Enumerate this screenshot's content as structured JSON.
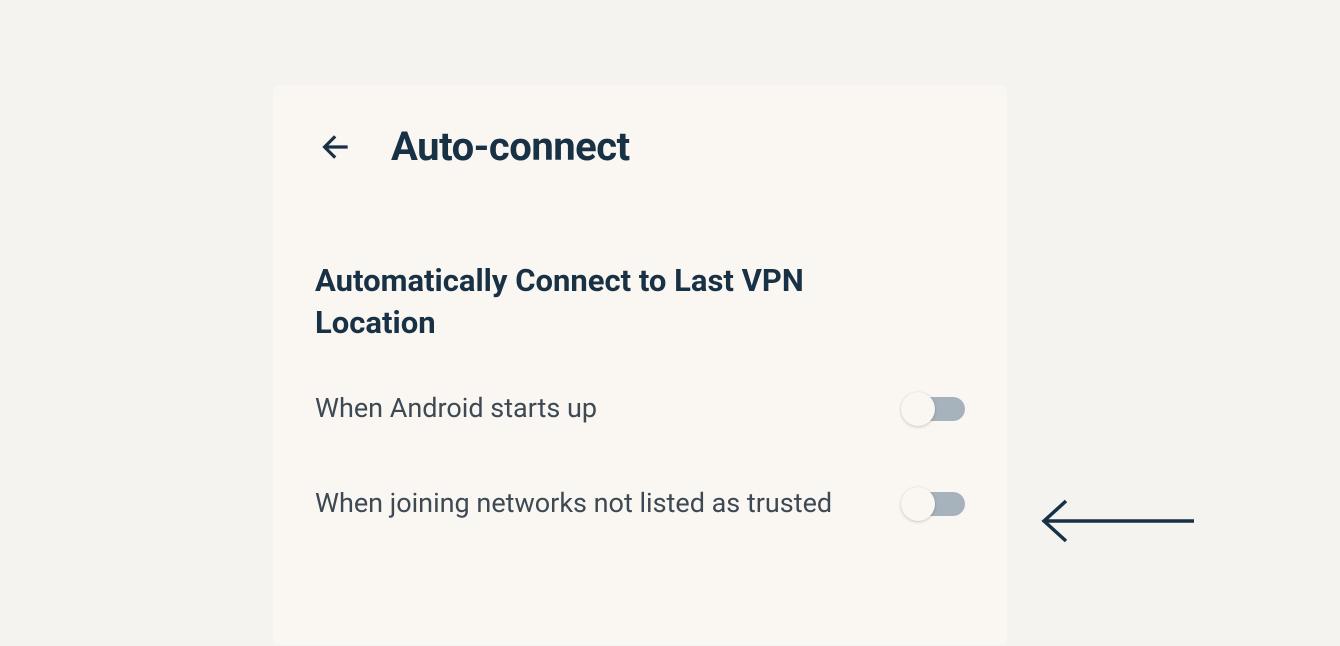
{
  "header": {
    "title": "Auto-connect"
  },
  "section": {
    "heading": "Automatically Connect to Last VPN Location"
  },
  "settings": [
    {
      "label": "When Android starts up",
      "enabled": false
    },
    {
      "label": "When joining networks not listed as trusted",
      "enabled": false
    }
  ]
}
